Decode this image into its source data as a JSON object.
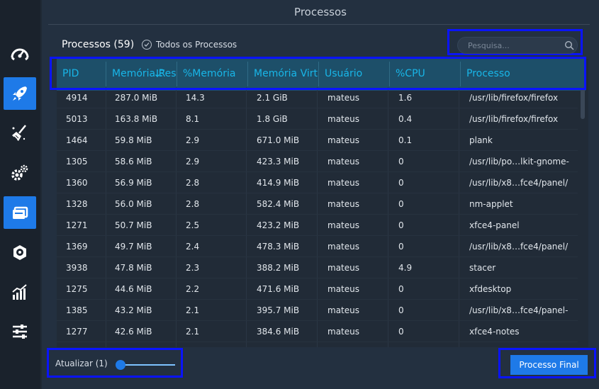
{
  "window": {
    "title": "Processos"
  },
  "sidebar": {
    "items": [
      {
        "icon": "dashboard-icon",
        "active": false
      },
      {
        "icon": "rocket-icon",
        "active": true
      },
      {
        "icon": "broom-icon",
        "active": false
      },
      {
        "icon": "gears-icon",
        "active": false
      },
      {
        "icon": "processes-icon",
        "active": true
      },
      {
        "icon": "uninstaller-icon",
        "active": false
      },
      {
        "icon": "chart-icon",
        "active": false
      },
      {
        "icon": "sliders-icon",
        "active": false
      }
    ]
  },
  "toolbar": {
    "count_label": "Processos (59)",
    "all_processes_label": "Todos os Processos",
    "search_placeholder": "Pesquisa...",
    "search_value": ""
  },
  "table": {
    "columns": [
      "PID",
      "Memória Res",
      "%Memória",
      "Memória Virt",
      "Usuário",
      "%CPU",
      "Processo"
    ],
    "rows": [
      [
        "4914",
        "287.0 MiB",
        "14.3",
        "2.1 GiB",
        "mateus",
        "1.6",
        "/usr/lib/firefox/firefox"
      ],
      [
        "5013",
        "163.8 MiB",
        "8.1",
        "1.8 GiB",
        "mateus",
        "0.4",
        "/usr/lib/firefox/firefox"
      ],
      [
        "1464",
        "59.8 MiB",
        "2.9",
        "671.0 MiB",
        "mateus",
        "0.1",
        "plank"
      ],
      [
        "1305",
        "58.6 MiB",
        "2.9",
        "423.3 MiB",
        "mateus",
        "0",
        "/usr/lib/po…lkit-gnome-"
      ],
      [
        "1360",
        "56.9 MiB",
        "2.8",
        "414.9 MiB",
        "mateus",
        "0",
        "/usr/lib/x8…fce4/panel/"
      ],
      [
        "1328",
        "56.0 MiB",
        "2.8",
        "582.4 MiB",
        "mateus",
        "0",
        "nm-applet"
      ],
      [
        "1271",
        "50.7 MiB",
        "2.5",
        "423.2 MiB",
        "mateus",
        "0",
        "xfce4-panel"
      ],
      [
        "1369",
        "49.7 MiB",
        "2.4",
        "478.3 MiB",
        "mateus",
        "0",
        "/usr/lib/x8…fce4/panel/"
      ],
      [
        "3938",
        "47.8 MiB",
        "2.3",
        "388.2 MiB",
        "mateus",
        "4.9",
        "stacer"
      ],
      [
        "1275",
        "44.6 MiB",
        "2.2",
        "471.6 MiB",
        "mateus",
        "0",
        "xfdesktop"
      ],
      [
        "1385",
        "43.2 MiB",
        "2.1",
        "395.7 MiB",
        "mateus",
        "0",
        "/usr/lib/x8…fce4/panel-"
      ],
      [
        "1277",
        "42.6 MiB",
        "2.1",
        "384.6 MiB",
        "mateus",
        "0",
        "xfce4-notes"
      ]
    ]
  },
  "footer": {
    "refresh_label": "Atualizar (1)",
    "refresh_value": 1,
    "end_button_label": "Processo Final"
  },
  "colors": {
    "accent": "#1e7ae8",
    "header_text": "#18b6e8",
    "highlight_border": "#0a14ff"
  }
}
